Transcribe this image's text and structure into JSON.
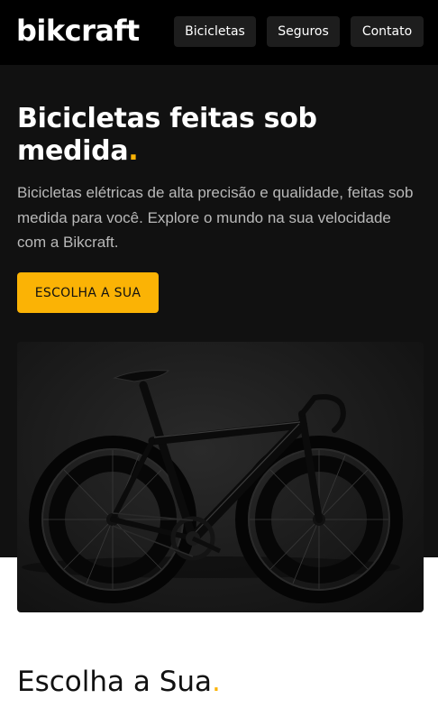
{
  "header": {
    "logo": "bikcraft",
    "nav": [
      "Bicicletas",
      "Seguros",
      "Contato"
    ]
  },
  "hero": {
    "title": "Bicicletas feitas sob medida",
    "title_dot": ".",
    "description": "Bicicletas elétricas de alta precisão e qualidade, feitas sob medida para você. Explore o mundo na sua velocidade com a Bikcraft.",
    "cta_label": "ESCOLHA A SUA",
    "image_icon": "bicycle-photo"
  },
  "section": {
    "title": "Escolha a Sua",
    "title_dot": "."
  },
  "colors": {
    "accent": "#fbb305",
    "header_bg": "#000000",
    "hero_bg": "#111111",
    "text_muted": "#b9b9b9"
  }
}
